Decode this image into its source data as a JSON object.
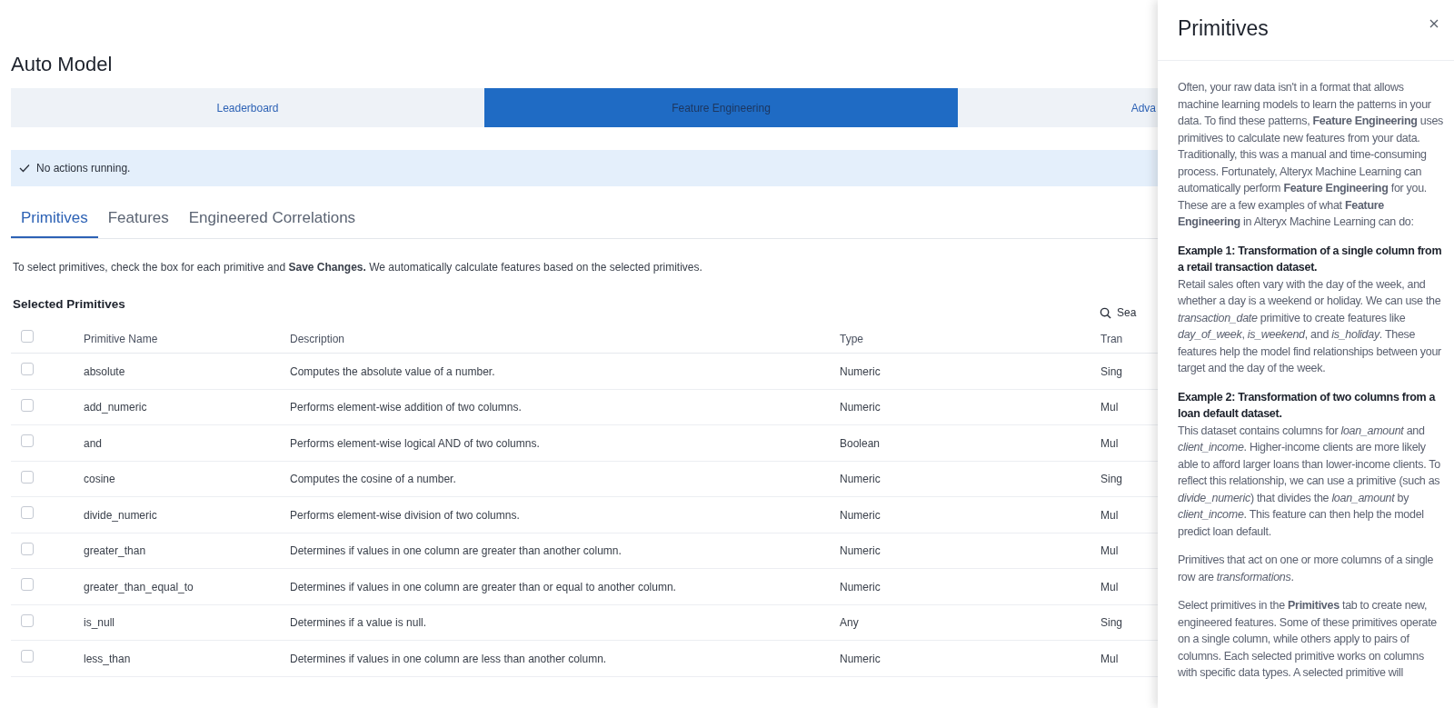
{
  "page": {
    "title": "Auto Model"
  },
  "nav_tabs": [
    {
      "label": "Leaderboard",
      "selected": false
    },
    {
      "label": "Feature Engineering",
      "selected": true
    },
    {
      "label": "Adva",
      "selected": false
    }
  ],
  "status_alert": {
    "text": "No actions running."
  },
  "sub_tabs": [
    {
      "label": "Primitives",
      "selected": true
    },
    {
      "label": "Features",
      "selected": false
    },
    {
      "label": "Engineered Correlations",
      "selected": false
    }
  ],
  "instructions": "To select primitives, check the box for each primitive and **Save Changes.** We automatically calculate features based on the selected primitives.",
  "section_title": "Selected Primitives",
  "search": {
    "placeholder": "Sea"
  },
  "table": {
    "select_all": {
      "checked": false
    },
    "columns": [
      "Primitive Name",
      "Description",
      "Type",
      "Tran"
    ],
    "rows": [
      {
        "checked": false,
        "cells": [
          "absolute",
          "Computes the absolute value of a number.",
          "Numeric",
          "Sing"
        ]
      },
      {
        "checked": false,
        "cells": [
          "add_numeric",
          "Performs element-wise addition of two columns.",
          "Numeric",
          "Mul"
        ]
      },
      {
        "checked": false,
        "cells": [
          "and",
          "Performs element-wise logical AND of two columns.",
          "Boolean",
          "Mul"
        ]
      },
      {
        "checked": false,
        "cells": [
          "cosine",
          "Computes the cosine of a number.",
          "Numeric",
          "Sing"
        ]
      },
      {
        "checked": false,
        "cells": [
          "divide_numeric",
          "Performs element-wise division of two columns.",
          "Numeric",
          "Mul"
        ]
      },
      {
        "checked": false,
        "cells": [
          "greater_than",
          "Determines if values in one column are greater than another column.",
          "Numeric",
          "Mul"
        ]
      },
      {
        "checked": false,
        "cells": [
          "greater_than_equal_to",
          "Determines if values in one column are greater than or equal to another column.",
          "Numeric",
          "Mul"
        ]
      },
      {
        "checked": false,
        "cells": [
          "is_null",
          "Determines if a value is null.",
          "Any",
          "Sing"
        ]
      },
      {
        "checked": false,
        "cells": [
          "less_than",
          "Determines if values in one column are less than another column.",
          "Numeric",
          "Mul"
        ]
      }
    ]
  },
  "side_panel": {
    "title": "Primitives",
    "sections": [
      {
        "text": "Often, your raw data isn't in a format that allows machine learning models to learn the patterns in your data. To find these patterns, **Feature Engineering** uses primitives to calculate new features from your data. Traditionally, this was a manual and time-consuming process. Fortunately, Alteryx Machine Learning can automatically perform **Feature Engineering** for you. These are a few examples of what **Feature Engineering** in Alteryx Machine Learning can do:"
      },
      {
        "heading": "Example 1: Transformation of a single column from a retail transaction dataset.",
        "text": "Retail sales often vary with the day of the week, and whether a day is a weekend or holiday. We can use the *transaction_date* primitive to create features like *day_of_week*, *is_weekend*, and *is_holiday*. These features help the model find relationships between your target and the day of the week."
      },
      {
        "heading": "Example 2: Transformation of two columns from a loan default dataset.",
        "text": "This dataset contains columns for *loan_amount* and *client_income*. Higher-income clients are more likely able to afford larger loans than lower-income clients. To reflect this relationship, we can use a primitive (such as *divide_numeric*) that divides the *loan_amount* by *client_income*. This feature can then help the model predict loan default."
      },
      {
        "text": "Primitives that act on one or more columns of a single row are *transformations*."
      },
      {
        "text": "Select primitives in the **Primitives** tab to create new, engineered features. Some of these primitives operate on a single column, while others apply to pairs of columns. Each selected primitive works on columns with specific data types. A selected primitive will"
      }
    ]
  }
}
